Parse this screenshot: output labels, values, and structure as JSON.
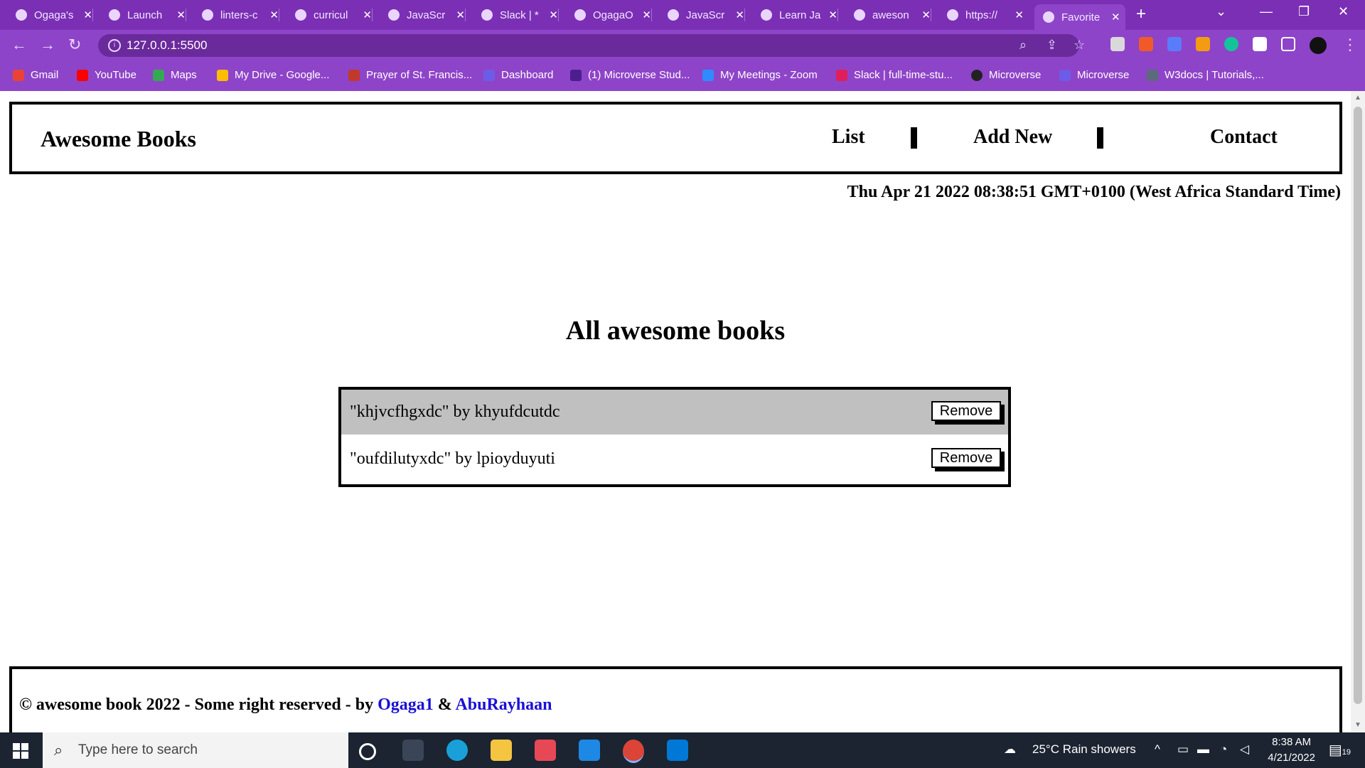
{
  "browser": {
    "tabs": [
      {
        "title": "Ogaga's"
      },
      {
        "title": "Launch"
      },
      {
        "title": "linters-c"
      },
      {
        "title": "curricul"
      },
      {
        "title": "JavaScr"
      },
      {
        "title": "Slack | *"
      },
      {
        "title": "OgagaO"
      },
      {
        "title": "JavaScr"
      },
      {
        "title": "Learn Ja"
      },
      {
        "title": "aweson"
      },
      {
        "title": "https://"
      },
      {
        "title": "Favorite"
      }
    ],
    "new_tab_label": "+",
    "url": "127.0.0.1:5500",
    "bookmarks": [
      {
        "label": "Gmail",
        "color": "#ea4335"
      },
      {
        "label": "YouTube",
        "color": "#ff0000"
      },
      {
        "label": "Maps",
        "color": "#34a853"
      },
      {
        "label": "My Drive - Google...",
        "color": "#fbbc04"
      },
      {
        "label": "Prayer of St. Francis...",
        "color": "#c0392b"
      },
      {
        "label": "Dashboard",
        "color": "#6c5ce7"
      },
      {
        "label": "(1) Microverse Stud...",
        "color": "#4b1f8c"
      },
      {
        "label": "My Meetings - Zoom",
        "color": "#2d8cff"
      },
      {
        "label": "Slack | full-time-stu...",
        "color": "#e01e5a"
      },
      {
        "label": "Microverse",
        "color": "#222222"
      },
      {
        "label": "Microverse",
        "color": "#6c5ce7"
      },
      {
        "label": "W3docs | Tutorials,...",
        "color": "#5b6b7b"
      }
    ]
  },
  "page": {
    "brand": "Awesome Books",
    "nav": {
      "list": "List",
      "add_new": "Add New",
      "contact": "Contact"
    },
    "datetime": "Thu Apr 21 2022 08:38:51 GMT+0100 (West Africa Standard Time)",
    "heading": "All awesome books",
    "books": [
      {
        "text": "\"khjvcfhgxdc\" by khyufdcutdc",
        "remove_label": "Remove"
      },
      {
        "text": "\"oufdilutyxdc\" by lpioyduyuti",
        "remove_label": "Remove"
      }
    ],
    "footer": {
      "prefix": "© awesome book 2022 - Some right reserved - by ",
      "author1": "Ogaga1",
      "joiner": " & ",
      "author2": "AbuRayhaan"
    }
  },
  "taskbar": {
    "search_placeholder": "Type here to search",
    "weather": "25°C  Rain showers",
    "time": "8:38 AM",
    "date": "4/21/2022",
    "notifications": "19"
  }
}
